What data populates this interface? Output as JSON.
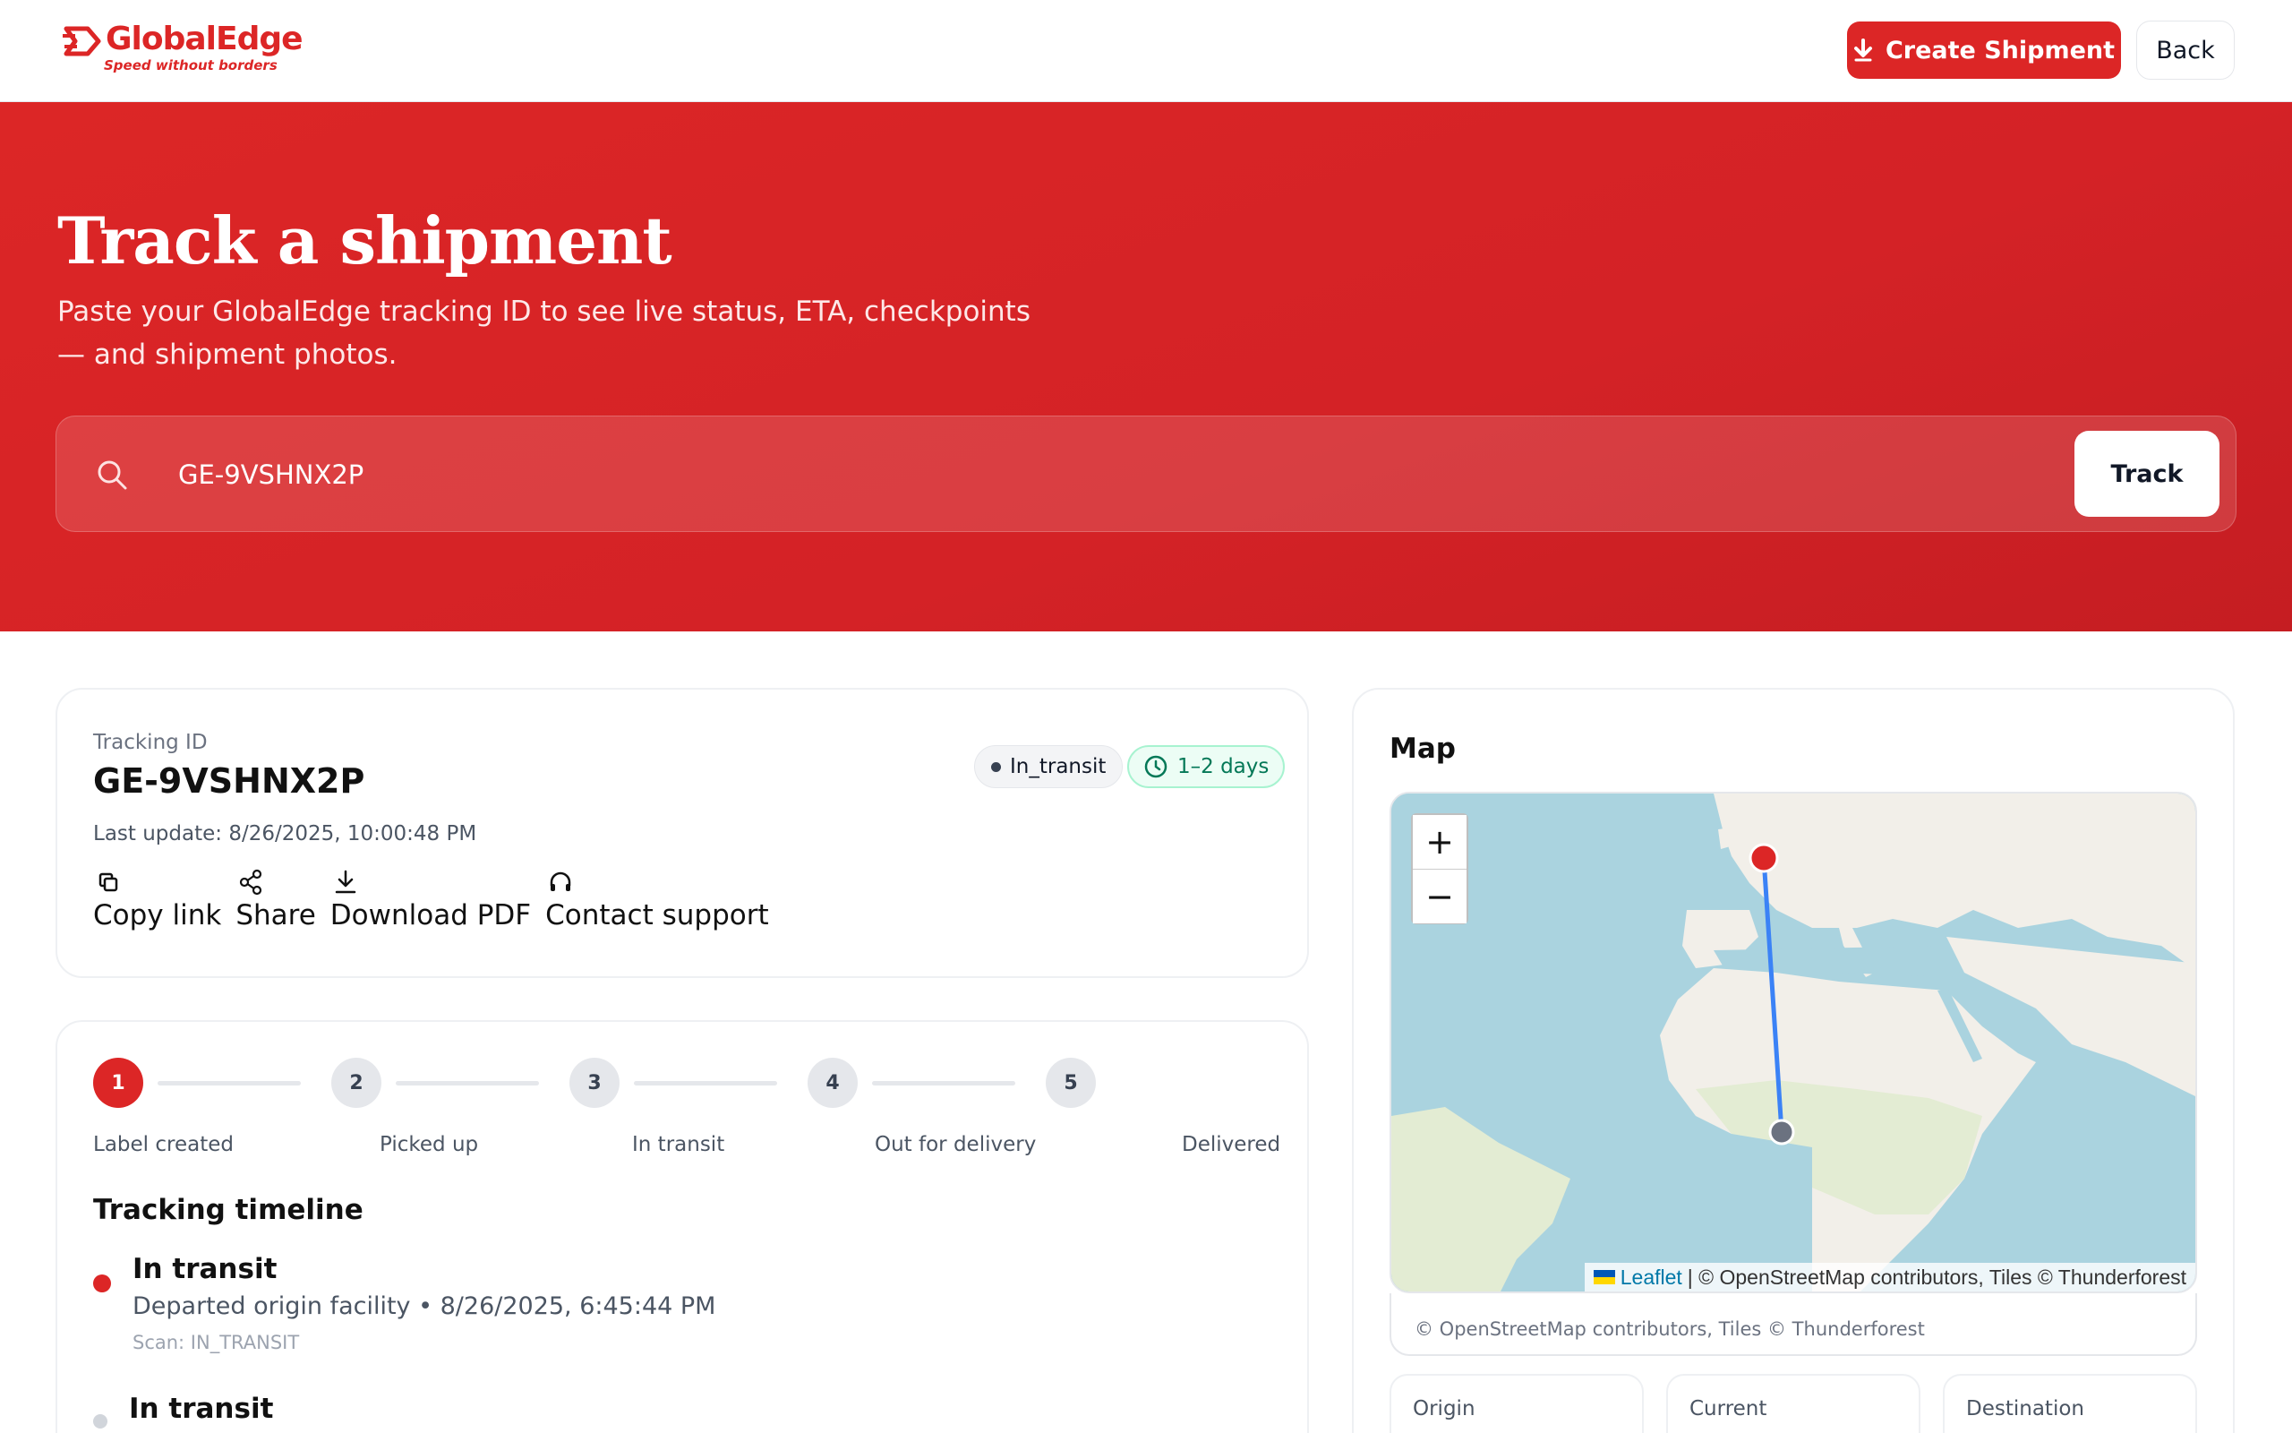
{
  "brand": {
    "name": "GlobalEdge",
    "tagline": "Speed without borders",
    "accent": "#dc2626"
  },
  "header": {
    "create_label": "Create Shipment",
    "create_icon": "download-arrow-icon",
    "back_label": "Back"
  },
  "hero": {
    "title": "Track a shipment",
    "subtitle": "Paste your GlobalEdge tracking ID to see live status, ETA, checkpoints — and shipment photos.",
    "search_value": "GE-9VSHNX2P",
    "track_label": "Track"
  },
  "shipment": {
    "id_label": "Tracking ID",
    "id": "GE-9VSHNX2P",
    "last_update": "Last update: 8/26/2025, 10:00:48 PM",
    "status": "In_transit",
    "eta": "1–2 days",
    "actions": [
      {
        "label": "Copy link",
        "icon": "copy-icon"
      },
      {
        "label": "Share",
        "icon": "share-icon"
      },
      {
        "label": "Download PDF",
        "icon": "download-icon"
      },
      {
        "label": "Contact support",
        "icon": "headset-icon"
      }
    ]
  },
  "progress": {
    "current_step": 1,
    "steps": [
      {
        "number": "1",
        "label": "Label created"
      },
      {
        "number": "2",
        "label": "Picked up"
      },
      {
        "number": "3",
        "label": "In transit"
      },
      {
        "number": "4",
        "label": "Out for delivery"
      },
      {
        "number": "5",
        "label": "Delivered"
      }
    ]
  },
  "timeline": {
    "title": "Tracking timeline",
    "events": [
      {
        "status": "In transit",
        "desc": "Departed origin facility • 8/26/2025, 6:45:44 PM",
        "scan": "Scan: IN_TRANSIT"
      },
      {
        "status": "In transit",
        "desc": "",
        "scan": ""
      }
    ]
  },
  "map": {
    "title": "Map",
    "zoom_in": "+",
    "zoom_out": "−",
    "attribution_link": "Leaflet",
    "attribution_text": "| © OpenStreetMap contributors, Tiles © Thunderforest",
    "footer": "© OpenStreetMap contributors, Tiles © Thunderforest",
    "route_color": "#3b82f6",
    "origin_color": "#dc2626",
    "current_color": "#6b7280"
  },
  "locations": {
    "origin": "Origin",
    "current": "Current",
    "destination": "Destination"
  }
}
